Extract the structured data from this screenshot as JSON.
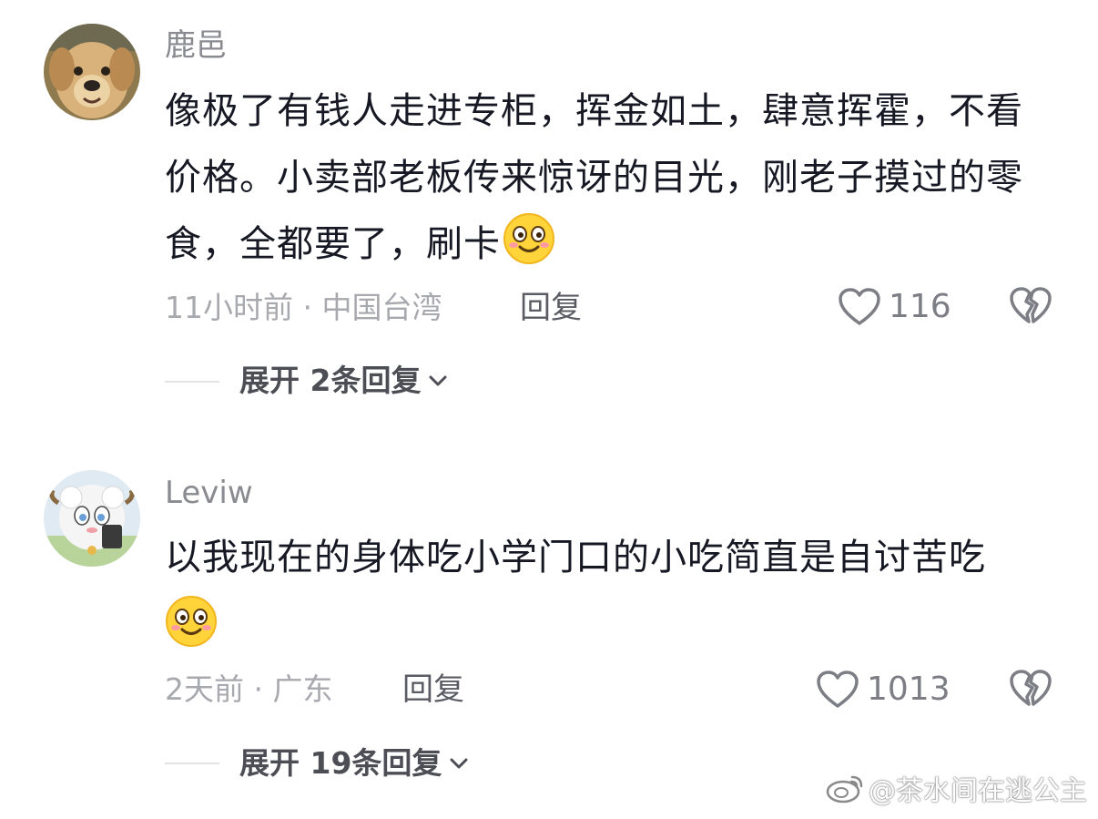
{
  "comments": [
    {
      "username": "鹿邑",
      "text": "像极了有钱人走进专柜，挥金如土，肆意挥霍，不看价格。小卖部老板传来惊讶的目光，刚老子摸过的零食，全都要了，刷卡",
      "emoji": "smile-blush-emoji",
      "meta": "11小时前 · 中国台湾",
      "reply_label": "回复",
      "like_count": "116",
      "expand_label": "展开 2条回复",
      "avatar": "dog-avatar"
    },
    {
      "username": "Leviw",
      "text": "以我现在的身体吃小学门口的小吃简直是自讨苦吃",
      "emoji": "smile-blush-emoji",
      "meta": "2天前 · 广东",
      "reply_label": "回复",
      "like_count": "1013",
      "expand_label": "展开 19条回复",
      "avatar": "sheep-cartoon-avatar"
    }
  ],
  "watermark": {
    "text": "@茶水间在逃公主",
    "icon": "weibo-icon"
  },
  "colors": {
    "text_primary": "#161823",
    "text_secondary": "#a8a9ae",
    "username": "#8a8b91",
    "emoji_yellow": "#ffd43b"
  }
}
